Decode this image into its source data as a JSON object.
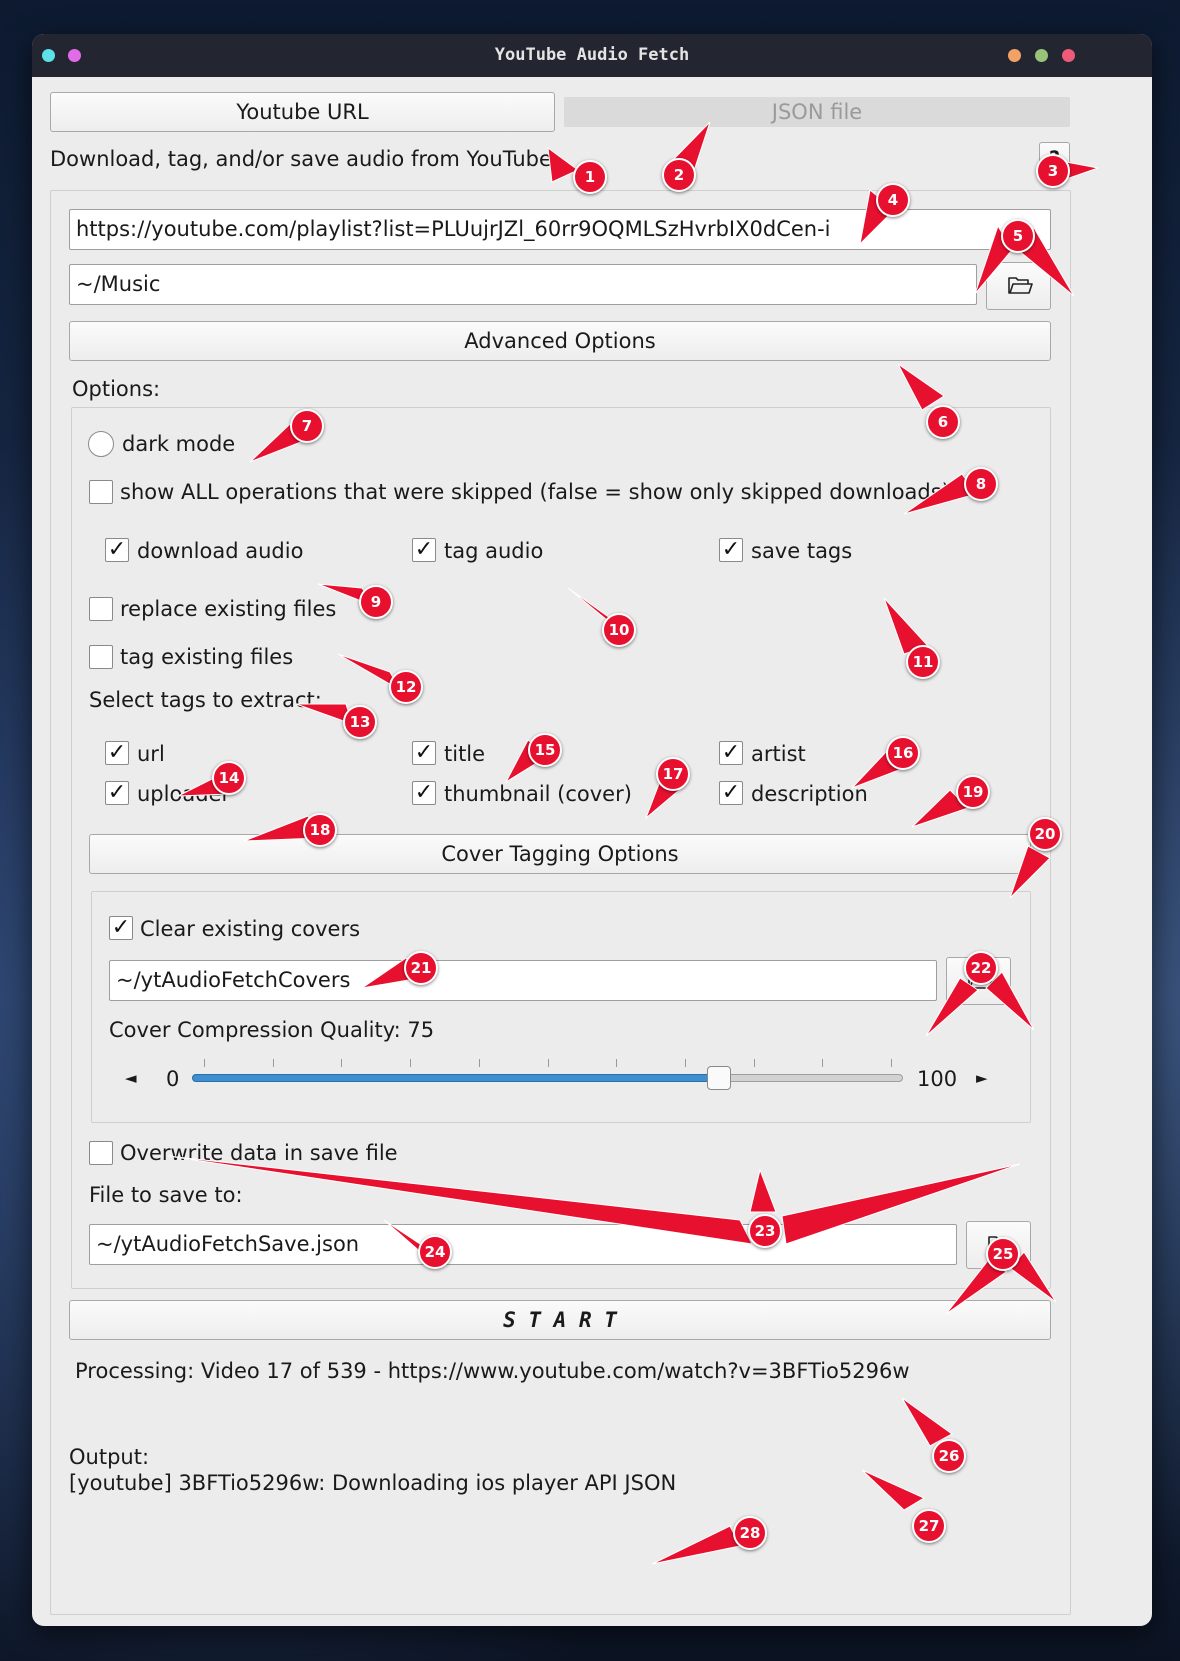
{
  "window": {
    "title": "YouTube Audio Fetch"
  },
  "tabs": {
    "youtube_url": "Youtube URL",
    "json_file": "JSON file"
  },
  "subtitle": "Download, tag, and/or save audio from YouTube",
  "help_button": "?",
  "inputs": {
    "url": "https://youtube.com/playlist?list=PLUujrJZl_60rr9OQMLSzHvrbIX0dCen-i",
    "output_dir": "~/Music",
    "covers_dir": "~/ytAudioFetchCovers",
    "save_file": "~/ytAudioFetchSave.json"
  },
  "advanced_options_label": "Advanced Options",
  "options_label": "Options:",
  "dark_mode": {
    "label": "dark mode",
    "checked": false
  },
  "show_skipped": {
    "label": "show ALL operations that were skipped (false = show only skipped downloads)",
    "checked": false
  },
  "operations": [
    {
      "label": "download audio",
      "checked": true
    },
    {
      "label": "tag audio",
      "checked": true
    },
    {
      "label": "save tags",
      "checked": true
    }
  ],
  "replace_existing": {
    "label": "replace existing files",
    "checked": false
  },
  "tag_existing": {
    "label": "tag existing files",
    "checked": false
  },
  "select_tags_label": "Select tags to extract:",
  "tags": [
    {
      "label": "url",
      "checked": true
    },
    {
      "label": "title",
      "checked": true
    },
    {
      "label": "artist",
      "checked": true
    },
    {
      "label": "uploader",
      "checked": true
    },
    {
      "label": "thumbnail (cover)",
      "checked": true
    },
    {
      "label": "description",
      "checked": true
    }
  ],
  "cover_tagging_label": "Cover Tagging Options",
  "clear_covers": {
    "label": "Clear existing covers",
    "checked": true
  },
  "compression": {
    "label": "Cover Compression Quality: 75",
    "value": 75,
    "min": 0,
    "max": 100,
    "min_label": "0",
    "max_label": "100",
    "left_arrow": "◄",
    "right_arrow": "►"
  },
  "overwrite": {
    "label": "Overwrite data in save file",
    "checked": false
  },
  "file_to_save_label": "File to save to:",
  "start_label": "S T A R T",
  "processing": "Processing: Video 17 of 539 - https://www.youtube.com/watch?v=3BFTio5296w",
  "output_label": "Output:",
  "output_line": "[youtube] 3BFTio5296w: Downloading ios player API JSON",
  "checkmark": "✓",
  "icons": {
    "folder": "folder-open-icon"
  },
  "colors": {
    "titlebar": "#232530",
    "window_bg": "#ececec",
    "slider_fill": "#3d8fd1",
    "callout": "#e8102f"
  },
  "markers": [
    "1",
    "2",
    "3",
    "4",
    "5",
    "6",
    "7",
    "8",
    "9",
    "10",
    "11",
    "12",
    "13",
    "14",
    "15",
    "16",
    "17",
    "18",
    "19",
    "20",
    "21",
    "22",
    "23",
    "24",
    "25",
    "26",
    "27",
    "28"
  ]
}
